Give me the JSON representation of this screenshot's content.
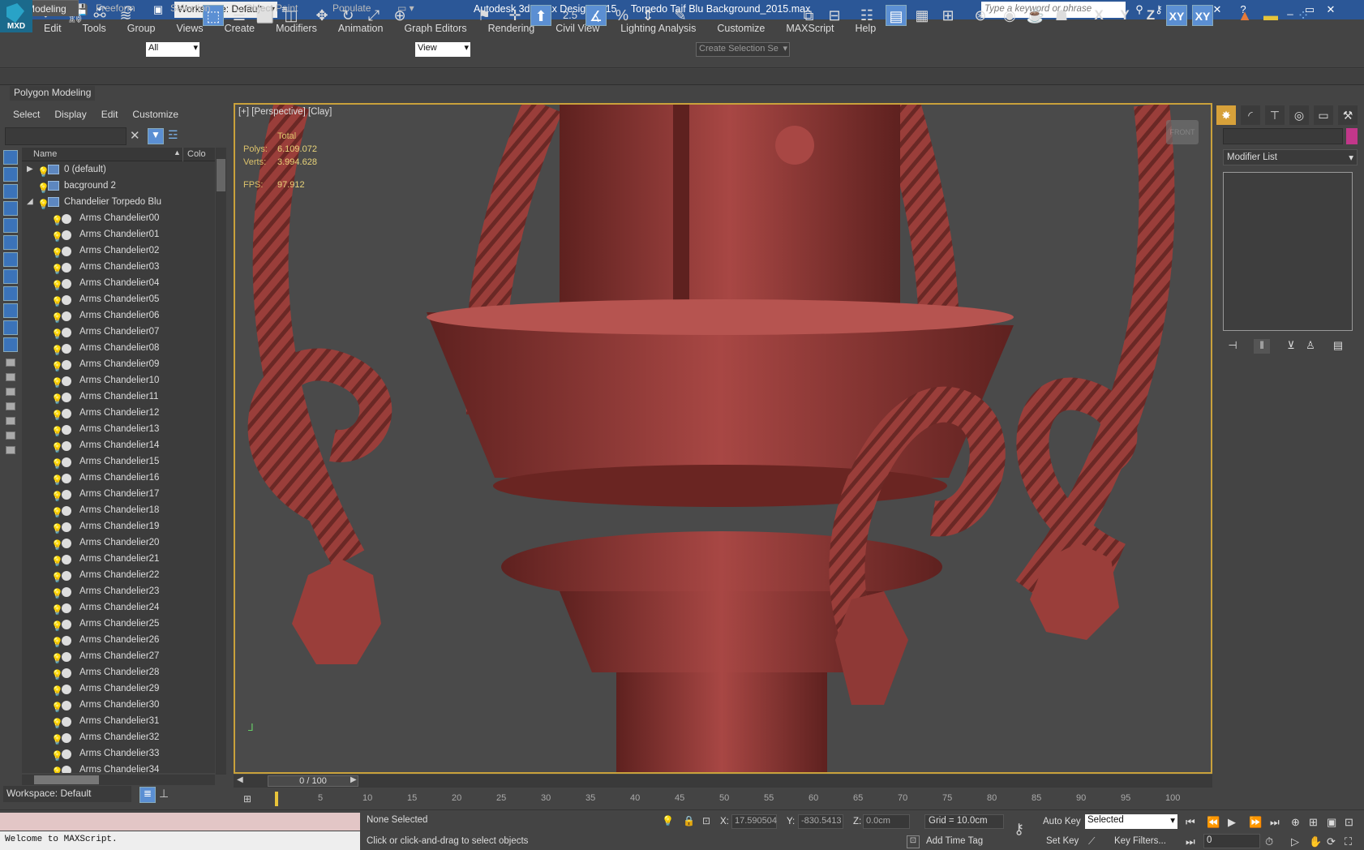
{
  "app": {
    "logo_text": "MXD",
    "title": "Autodesk 3ds Max Design 2015",
    "filename": "Torpedo Taif Blu Background_2015.max",
    "workspace": "Workspace: Default",
    "search_placeholder": "Type a keyword or phrase",
    "window_controls": [
      "_",
      "▭",
      "✕"
    ]
  },
  "menu": [
    "Edit",
    "Tools",
    "Group",
    "Views",
    "Create",
    "Modifiers",
    "Animation",
    "Graph Editors",
    "Rendering",
    "Civil View",
    "Lighting Analysis",
    "Customize",
    "MAXScript",
    "Help"
  ],
  "toolbar": {
    "filter": "All",
    "refcoord": "View",
    "snap_label": "2.5",
    "selection_set": "Create Selection Se",
    "axis_labels": [
      "X",
      "Y",
      "Z",
      "XY",
      "XY"
    ]
  },
  "ribbon": {
    "tabs": [
      "Modeling",
      "Freeform",
      "Selection",
      "Object Paint",
      "Populate"
    ],
    "panel": "Polygon Modeling"
  },
  "scene_explorer": {
    "menu": [
      "Select",
      "Display",
      "Edit",
      "Customize"
    ],
    "col_name": "Name",
    "col_color": "Colo",
    "layers": [
      {
        "label": "0 (default)",
        "expand": "▶"
      },
      {
        "label": "bacground 2",
        "expand": ""
      },
      {
        "label": "Chandelier Torpedo Blu",
        "expand": "◢"
      }
    ],
    "objects": [
      "Arms Chandelier00",
      "Arms Chandelier01",
      "Arms Chandelier02",
      "Arms Chandelier03",
      "Arms Chandelier04",
      "Arms Chandelier05",
      "Arms Chandelier06",
      "Arms Chandelier07",
      "Arms Chandelier08",
      "Arms Chandelier09",
      "Arms Chandelier10",
      "Arms Chandelier11",
      "Arms Chandelier12",
      "Arms Chandelier13",
      "Arms Chandelier14",
      "Arms Chandelier15",
      "Arms Chandelier16",
      "Arms Chandelier17",
      "Arms Chandelier18",
      "Arms Chandelier19",
      "Arms Chandelier20",
      "Arms Chandelier21",
      "Arms Chandelier22",
      "Arms Chandelier23",
      "Arms Chandelier24",
      "Arms Chandelier25",
      "Arms Chandelier26",
      "Arms Chandelier27",
      "Arms Chandelier28",
      "Arms Chandelier29",
      "Arms Chandelier30",
      "Arms Chandelier31",
      "Arms Chandelier32",
      "Arms Chandelier33",
      "Arms Chandelier34"
    ],
    "workspace": "Workspace: Default"
  },
  "viewport": {
    "label": "[+] [Perspective] [Clay]",
    "stats_header": "Total",
    "polys_label": "Polys:",
    "polys": "6.109.072",
    "verts_label": "Verts:",
    "verts": "3.994.628",
    "fps_label": "FPS:",
    "fps": "97.912",
    "viewcube": "FRONT",
    "clay_color": "#a0413d"
  },
  "command_panel": {
    "modifier_list": "Modifier List",
    "swatch_color": "#c2378a"
  },
  "timeline": {
    "frame_label": "0 / 100",
    "ticks": [
      "5",
      "10",
      "15",
      "20",
      "25",
      "30",
      "35",
      "40",
      "45",
      "50",
      "55",
      "60",
      "65",
      "70",
      "75",
      "80",
      "85",
      "90",
      "95",
      "100"
    ]
  },
  "status": {
    "maxscript_output": "Welcome to MAXScript.",
    "selection": "None Selected",
    "prompt": "Click or click-and-drag to select objects",
    "x_label": "X:",
    "x": "17.590504",
    "y_label": "Y:",
    "y": "-830.5413",
    "z_label": "Z:",
    "z": "0.0cm",
    "grid": "Grid = 10.0cm",
    "auto_key": "Auto Key",
    "set_key": "Set Key",
    "selected": "Selected",
    "add_time_tag": "Add Time Tag",
    "key_filters": "Key Filters...",
    "frame": "0"
  }
}
